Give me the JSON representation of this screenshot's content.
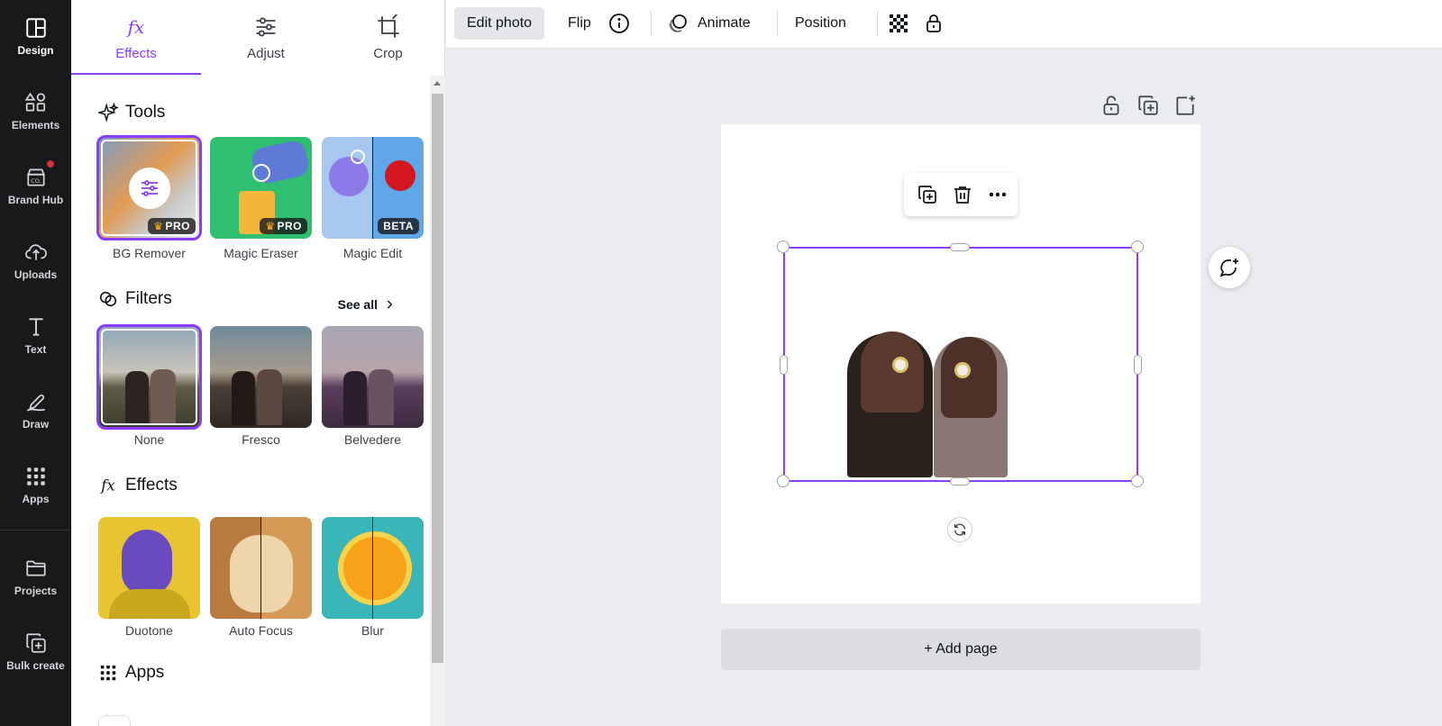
{
  "rail": {
    "items": [
      {
        "label": "Design",
        "icon": "layout-icon"
      },
      {
        "label": "Elements",
        "icon": "shapes-icon"
      },
      {
        "label": "Brand Hub",
        "icon": "brand-icon"
      },
      {
        "label": "Uploads",
        "icon": "cloud-upload-icon"
      },
      {
        "label": "Text",
        "icon": "text-icon"
      },
      {
        "label": "Draw",
        "icon": "draw-icon"
      },
      {
        "label": "Apps",
        "icon": "grid-icon"
      },
      {
        "label": "Projects",
        "icon": "folder-icon"
      },
      {
        "label": "Bulk create",
        "icon": "bulk-create-icon"
      }
    ],
    "active": "Design",
    "brand_icon_text": "CO.",
    "notification_color": "#d6323c"
  },
  "panel": {
    "tabs": [
      {
        "label": "Effects",
        "icon": "fx-icon"
      },
      {
        "label": "Adjust",
        "icon": "sliders-icon"
      },
      {
        "label": "Crop",
        "icon": "crop-icon"
      }
    ],
    "active_tab": "Effects",
    "accent": "#8b3dff",
    "tools": {
      "title": "Tools",
      "items": [
        {
          "label": "BG Remover",
          "badge": "PRO"
        },
        {
          "label": "Magic Eraser",
          "badge": "PRO"
        },
        {
          "label": "Magic Edit",
          "badge": "BETA"
        }
      ]
    },
    "filters": {
      "title": "Filters",
      "see_all": "See all",
      "items": [
        {
          "label": "None"
        },
        {
          "label": "Fresco"
        },
        {
          "label": "Belvedere"
        }
      ]
    },
    "effects": {
      "title": "Effects",
      "items": [
        {
          "label": "Duotone"
        },
        {
          "label": "Auto Focus"
        },
        {
          "label": "Blur"
        }
      ]
    },
    "apps": {
      "title": "Apps"
    }
  },
  "toolbar": {
    "edit_photo": "Edit photo",
    "flip": "Flip",
    "animate": "Animate",
    "position": "Position"
  },
  "canvas": {
    "add_page": "+ Add page"
  }
}
